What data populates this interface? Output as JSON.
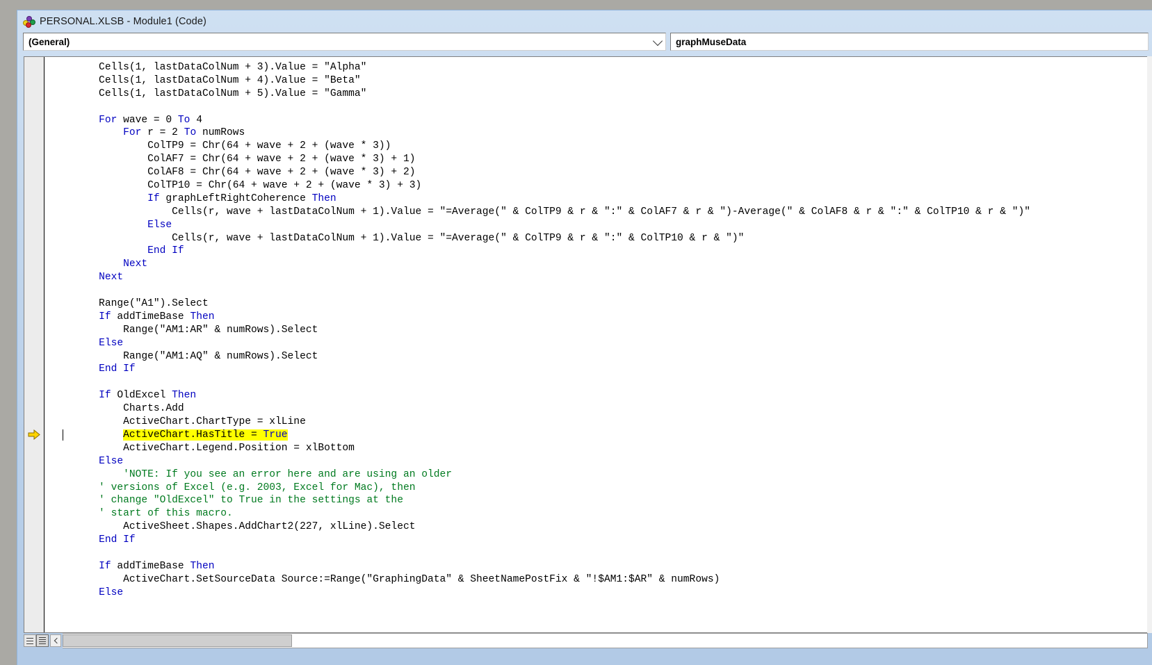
{
  "window": {
    "title": "PERSONAL.XLSB - Module1 (Code)",
    "icon": "vba-module-icon"
  },
  "toolbars": {
    "object_combo": {
      "value": "(General)",
      "icon": "chevron-down-icon"
    },
    "procedure_combo": {
      "value": "graphMuseData"
    }
  },
  "editor": {
    "execution_marker": "yellow-arrow-icon",
    "highlighted_line_index": 28,
    "colors": {
      "keyword": "#0000c0",
      "comment": "#007a1f",
      "highlight": "#ffff00",
      "text": "#000000",
      "background": "#ffffff"
    },
    "lines": [
      {
        "t": "        Cells(1, lastDataColNum + 3).Value = \"Alpha\""
      },
      {
        "t": "        Cells(1, lastDataColNum + 4).Value = \"Beta\""
      },
      {
        "t": "        Cells(1, lastDataColNum + 5).Value = \"Gamma\""
      },
      {
        "t": ""
      },
      {
        "t": "        For wave = 0 To 4"
      },
      {
        "t": "            For r = 2 To numRows"
      },
      {
        "t": "                ColTP9 = Chr(64 + wave + 2 + (wave * 3))"
      },
      {
        "t": "                ColAF7 = Chr(64 + wave + 2 + (wave * 3) + 1)"
      },
      {
        "t": "                ColAF8 = Chr(64 + wave + 2 + (wave * 3) + 2)"
      },
      {
        "t": "                ColTP10 = Chr(64 + wave + 2 + (wave * 3) + 3)"
      },
      {
        "t": "                If graphLeftRightCoherence Then"
      },
      {
        "t": "                    Cells(r, wave + lastDataColNum + 1).Value = \"=Average(\" & ColTP9 & r & \":\" & ColAF7 & r & \")-Average(\" & ColAF8 & r & \":\" & ColTP10 & r & \")\""
      },
      {
        "t": "                Else"
      },
      {
        "t": "                    Cells(r, wave + lastDataColNum + 1).Value = \"=Average(\" & ColTP9 & r & \":\" & ColTP10 & r & \")\""
      },
      {
        "t": "                End If"
      },
      {
        "t": "            Next"
      },
      {
        "t": "        Next"
      },
      {
        "t": ""
      },
      {
        "t": "        Range(\"A1\").Select"
      },
      {
        "t": "        If addTimeBase Then"
      },
      {
        "t": "            Range(\"AM1:AR\" & numRows).Select"
      },
      {
        "t": "        Else"
      },
      {
        "t": "            Range(\"AM1:AQ\" & numRows).Select"
      },
      {
        "t": "        End If"
      },
      {
        "t": ""
      },
      {
        "t": "        If OldExcel Then"
      },
      {
        "t": "            Charts.Add"
      },
      {
        "t": "            ActiveChart.ChartType = xlLine"
      },
      {
        "t": "            ActiveChart.HasTitle = True"
      },
      {
        "t": "            ActiveChart.Legend.Position = xlBottom"
      },
      {
        "t": "        Else"
      },
      {
        "t": "            'NOTE: If you see an error here and are using an older"
      },
      {
        "t": "        ' versions of Excel (e.g. 2003, Excel for Mac), then"
      },
      {
        "t": "        ' change \"OldExcel\" to True in the settings at the"
      },
      {
        "t": "        ' start of this macro."
      },
      {
        "t": "            ActiveSheet.Shapes.AddChart2(227, xlLine).Select"
      },
      {
        "t": "        End If"
      },
      {
        "t": ""
      },
      {
        "t": "        If addTimeBase Then"
      },
      {
        "t": "            ActiveChart.SetSourceData Source:=Range(\"GraphingData\" & SheetNamePostFix & \"!$AM1:$AR\" & numRows)"
      },
      {
        "t": "        Else"
      }
    ]
  },
  "bottom": {
    "procedure_view_button": "procedure-view",
    "full_module_view_button": "full-module-view",
    "scroll_left_button": "scroll-left"
  }
}
